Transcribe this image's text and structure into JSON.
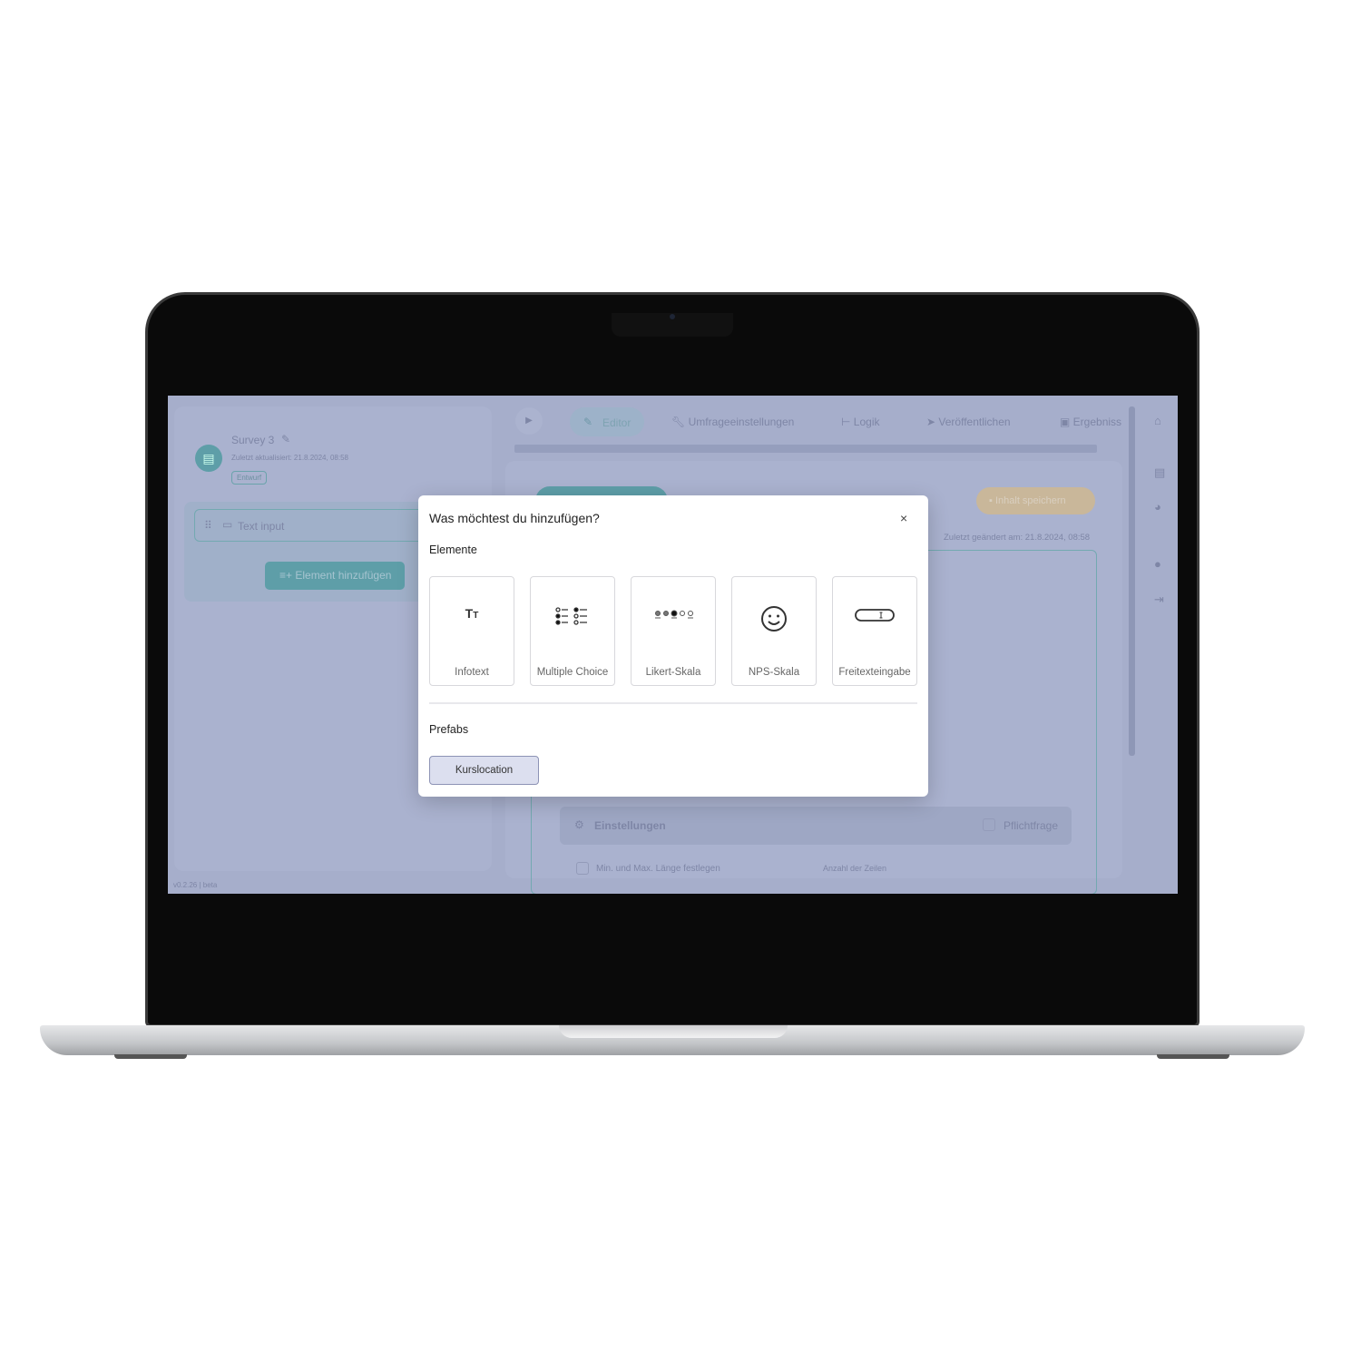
{
  "sidebar": {
    "survey_title": "Survey 3",
    "updated": "Zuletzt aktualisiert: 21.8.2024, 08:58",
    "status_badge": "Entwurf",
    "item_label": "Text input",
    "add_button": "Element hinzufügen",
    "version": "v0.2.26 | beta"
  },
  "tabs": [
    {
      "label": "Editor",
      "icon": "pencil-icon"
    },
    {
      "label": "Umfrageeinstellungen",
      "icon": "wrench-icon"
    },
    {
      "label": "Logik",
      "icon": "branch-icon"
    },
    {
      "label": "Veröffentlichen",
      "icon": "send-icon"
    },
    {
      "label": "Ergebniss",
      "icon": "chart-icon"
    }
  ],
  "main": {
    "save_button": "Inhalt speichern",
    "last_changed": "Zuletzt geändert am: 21.8.2024, 08:58",
    "settings_label": "Einstellungen",
    "required_label": "Pflichtfrage",
    "minmax_label": "Min. und Max. Länge festlegen",
    "rows_label": "Anzahl der Zeilen"
  },
  "modal": {
    "title": "Was möchtest du hinzufügen?",
    "close": "×",
    "elements_heading": "Elemente",
    "elements": [
      {
        "label": "Infotext",
        "icon": "text-icon"
      },
      {
        "label": "Multiple Choice",
        "icon": "multiple-choice-icon"
      },
      {
        "label": "Likert-Skala",
        "icon": "likert-icon"
      },
      {
        "label": "NPS-Skala",
        "icon": "smiley-icon"
      },
      {
        "label": "Freitexteingabe",
        "icon": "text-field-icon"
      }
    ],
    "prefabs_heading": "Prefabs",
    "prefabs": [
      "Kurslocation"
    ]
  },
  "colors": {
    "accent": "#5e9ea8",
    "overlay": "#a6aecb",
    "save": "#c9b79a"
  }
}
